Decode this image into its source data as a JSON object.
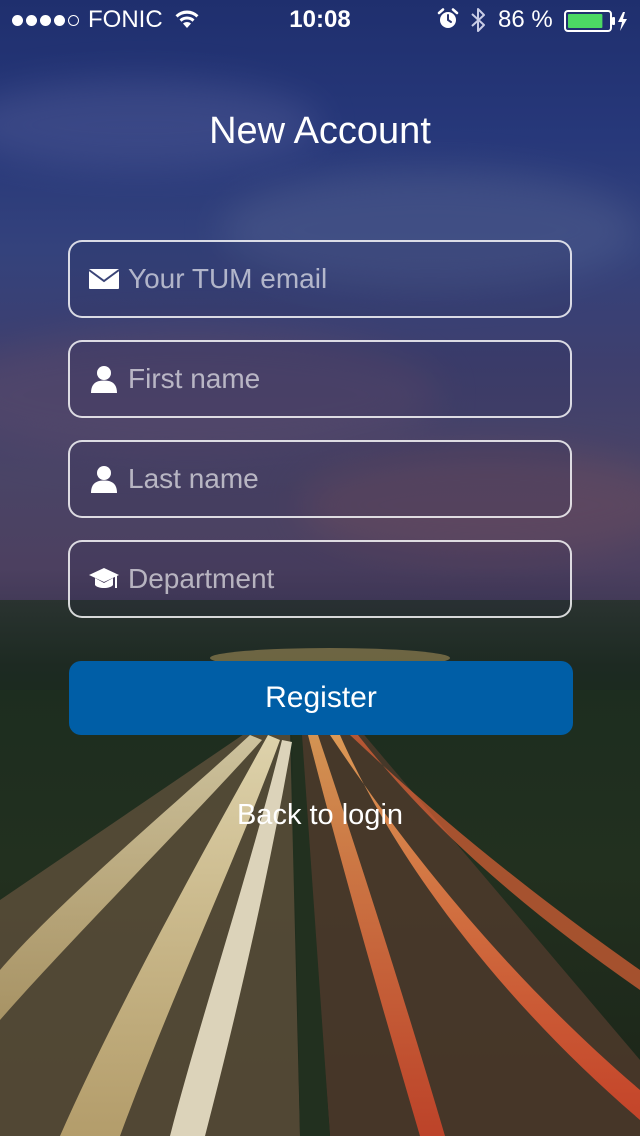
{
  "status_bar": {
    "carrier": "FONIC",
    "time": "10:08",
    "battery": "86 %",
    "battery_level": 0.86,
    "signal_bars_filled": 4,
    "signal_bars_total": 5,
    "icons": [
      "wifi-icon",
      "alarm-icon",
      "bluetooth-icon",
      "battery-icon",
      "charging-icon"
    ]
  },
  "title": "New Account",
  "form": {
    "email": {
      "placeholder": "Your TUM email",
      "value": "",
      "icon": "envelope-icon"
    },
    "first_name": {
      "placeholder": "First name",
      "value": "",
      "icon": "person-icon"
    },
    "last_name": {
      "placeholder": "Last name",
      "value": "",
      "icon": "person-icon"
    },
    "department": {
      "placeholder": "Department",
      "value": "",
      "icon": "graduation-cap-icon"
    }
  },
  "register_label": "Register",
  "back_label": "Back to login",
  "colors": {
    "primary_button": "#005ea6",
    "text": "#ffffff",
    "battery_fill": "#4cd964"
  }
}
